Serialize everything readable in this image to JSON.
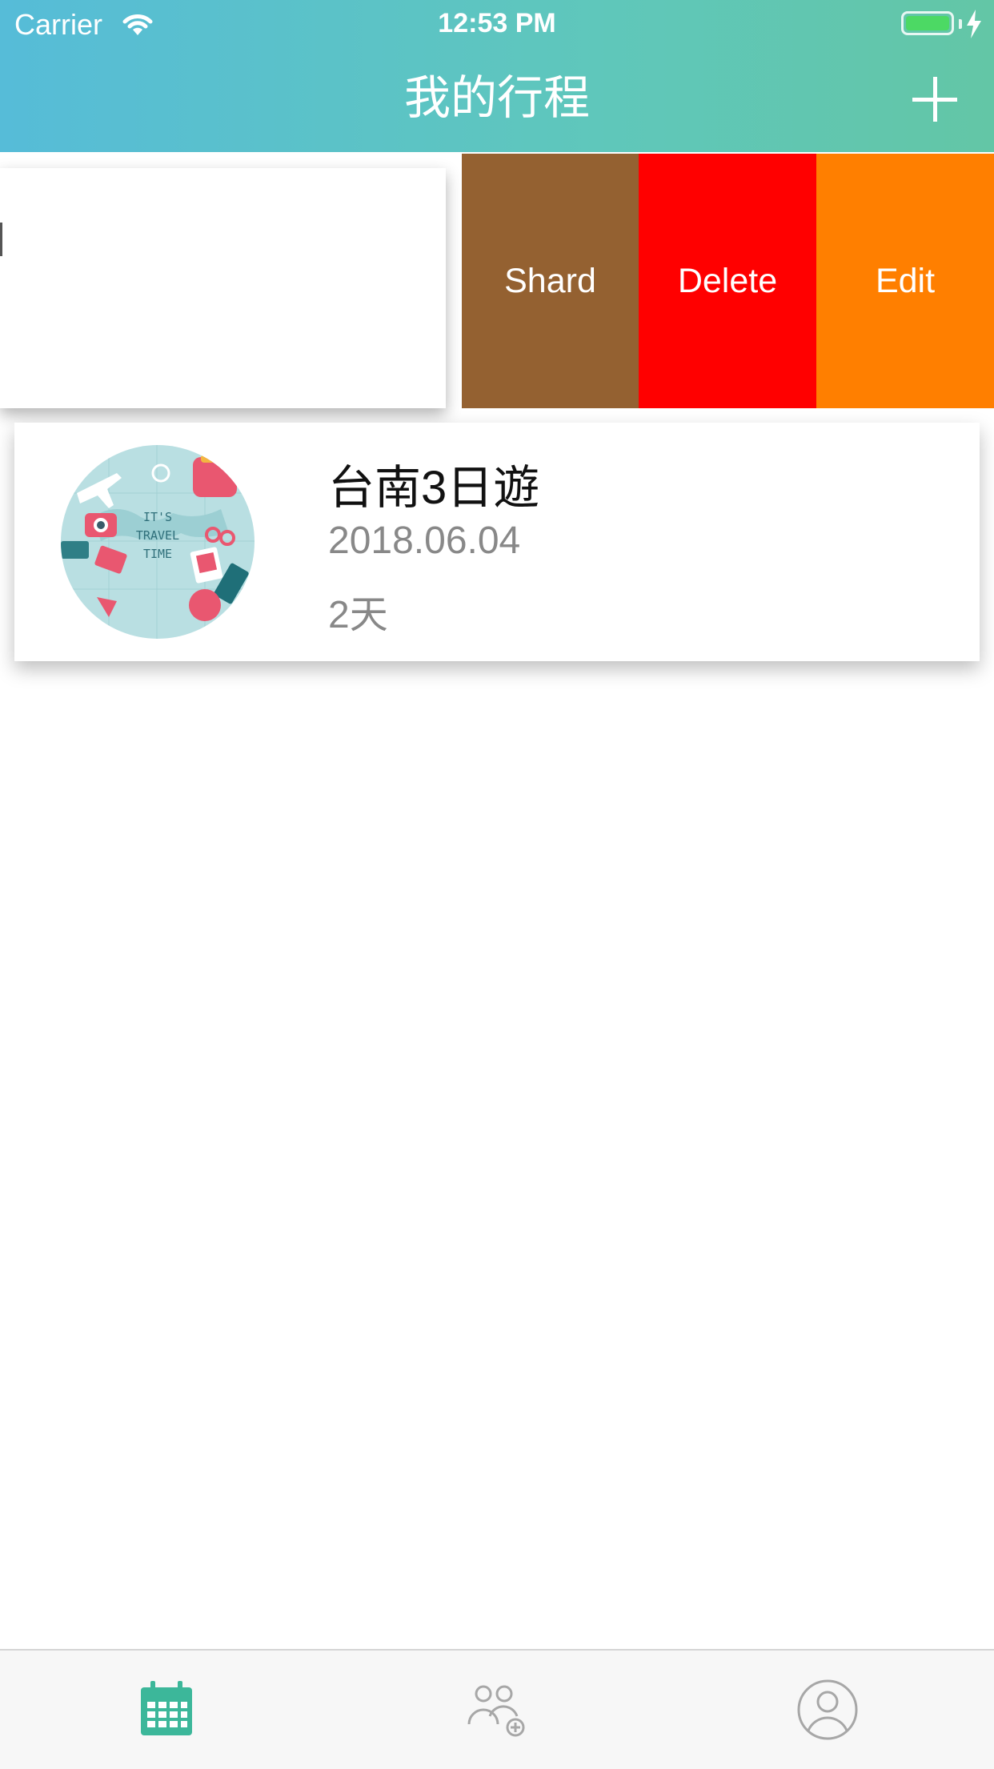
{
  "status_bar": {
    "carrier": "Carrier",
    "time": "12:53 PM"
  },
  "nav": {
    "title": "我的行程",
    "add_icon": "plus-icon"
  },
  "swipe_actions": {
    "shard": "Shard",
    "delete": "Delete",
    "edit": "Edit"
  },
  "colors": {
    "shard": "#946131",
    "delete": "#ff0000",
    "edit": "#ff7f00",
    "tab_active": "#3cb79a",
    "tab_inactive": "#a7a7a7"
  },
  "trip": {
    "title": "台南3日遊",
    "date": "2018.06.04",
    "days": "2天",
    "thumb_text": [
      "IT'S",
      "TRAVEL",
      "TIME"
    ]
  },
  "tabs": [
    {
      "icon": "calendar-icon",
      "active": true
    },
    {
      "icon": "group-add-icon",
      "active": false
    },
    {
      "icon": "profile-icon",
      "active": false
    }
  ]
}
